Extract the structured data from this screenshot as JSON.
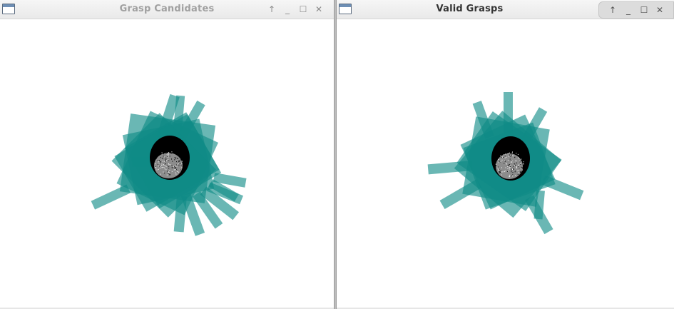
{
  "windows": {
    "candidates": {
      "title": "Grasp Candidates",
      "controls": {
        "up": "↑",
        "minimize": "_",
        "maximize": "☐",
        "close": "✕"
      }
    },
    "valid": {
      "title": "Valid Grasps",
      "controls": {
        "up": "↑",
        "minimize": "_",
        "maximize": "☐",
        "close": "✕"
      }
    }
  },
  "colors": {
    "gripper": "#0f8a86",
    "object": "#000000",
    "background": "#ffffff"
  }
}
